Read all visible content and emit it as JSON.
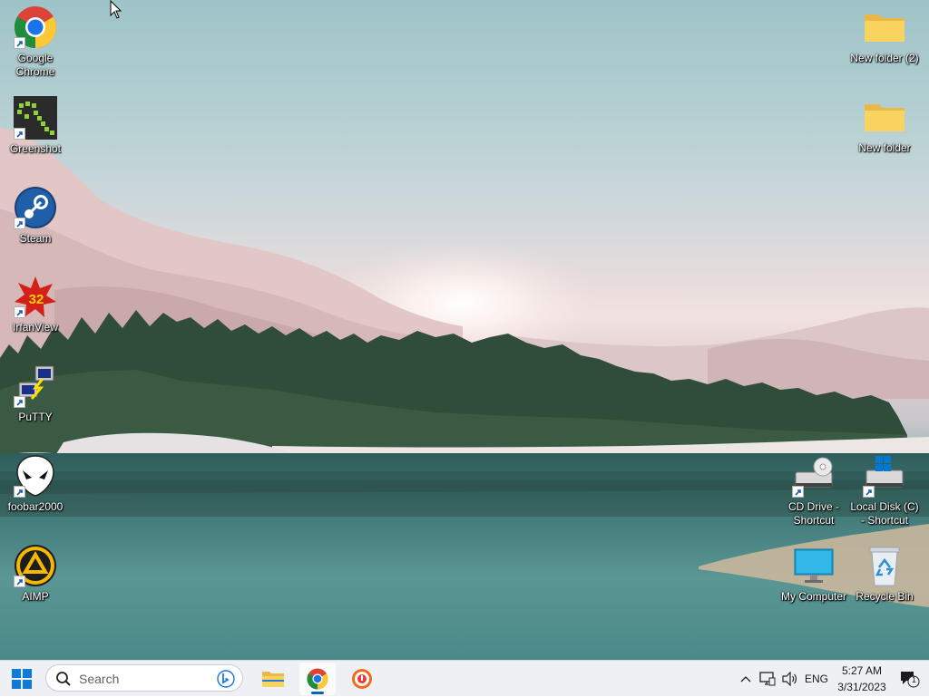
{
  "desktop": {
    "left_icons": [
      {
        "name": "google-chrome",
        "label": "Google Chrome",
        "icon": "chrome-icon"
      },
      {
        "name": "greenshot",
        "label": "Greenshot",
        "icon": "greenshot-icon"
      },
      {
        "name": "steam",
        "label": "Steam",
        "icon": "steam-icon"
      },
      {
        "name": "irfanview",
        "label": "IrfanView",
        "icon": "irfanview-icon"
      },
      {
        "name": "putty",
        "label": "PuTTY",
        "icon": "putty-icon"
      },
      {
        "name": "foobar2000",
        "label": "foobar2000",
        "icon": "foobar-icon"
      },
      {
        "name": "aimp",
        "label": "AIMP",
        "icon": "aimp-icon"
      }
    ],
    "right_icons": [
      {
        "name": "new-folder-2",
        "label": "New folder (2)",
        "icon": "folder-icon"
      },
      {
        "name": "new-folder",
        "label": "New folder",
        "icon": "folder-icon"
      },
      {
        "name": "cd-drive-shortcut",
        "label": "CD Drive - Shortcut",
        "icon": "cd-drive-icon"
      },
      {
        "name": "local-disk-shortcut",
        "label": "Local Disk (C) - Shortcut",
        "icon": "local-disk-icon"
      },
      {
        "name": "my-computer",
        "label": "My Computer",
        "icon": "monitor-icon"
      },
      {
        "name": "recycle-bin",
        "label": "Recycle Bin",
        "icon": "recycle-bin-icon"
      }
    ]
  },
  "taskbar": {
    "search_placeholder": "Search",
    "pinned": [
      {
        "name": "file-explorer",
        "icon": "folder-icon",
        "active": false
      },
      {
        "name": "chrome",
        "icon": "chrome-icon",
        "active": true
      },
      {
        "name": "app-orange",
        "icon": "orange-app-icon",
        "active": false
      }
    ],
    "tray": {
      "language": "ENG",
      "time": "5:27 AM",
      "date": "3/31/2023",
      "notification_count": "1"
    }
  },
  "colors": {
    "taskbar_bg": "#eef0f3",
    "accent": "#0067c0",
    "folder_yellow": "#f8d35e"
  }
}
